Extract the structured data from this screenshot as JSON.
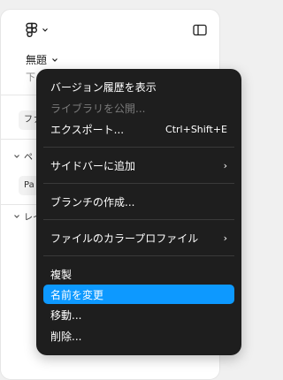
{
  "file": {
    "name": "無題",
    "subtitle": "下"
  },
  "left_panel": {
    "tab_label": "ファ",
    "pages_section": "ペ",
    "page_item": "Pa",
    "layers_section": "レイ"
  },
  "menu": {
    "items": [
      {
        "label": "バージョン履歴を表示",
        "shortcut": "",
        "submenu": false,
        "disabled": false
      },
      {
        "label": "ライブラリを公開...",
        "shortcut": "",
        "submenu": false,
        "disabled": true
      },
      {
        "label": "エクスポート...",
        "shortcut": "Ctrl+Shift+E",
        "submenu": false,
        "disabled": false
      },
      {
        "label": "サイドバーに追加",
        "shortcut": "",
        "submenu": true,
        "disabled": false
      },
      {
        "label": "ブランチの作成...",
        "shortcut": "",
        "submenu": false,
        "disabled": false
      },
      {
        "label": "ファイルのカラープロファイル",
        "shortcut": "",
        "submenu": true,
        "disabled": false
      },
      {
        "label": "複製",
        "shortcut": "",
        "submenu": false,
        "disabled": false
      },
      {
        "label": "名前を変更",
        "shortcut": "",
        "submenu": false,
        "disabled": false,
        "highlighted": true
      },
      {
        "label": "移動...",
        "shortcut": "",
        "submenu": false,
        "disabled": false
      },
      {
        "label": "削除...",
        "shortcut": "",
        "submenu": false,
        "disabled": false
      }
    ],
    "submenu_arrow": "›"
  },
  "colors": {
    "menu_bg": "#1e1e1e",
    "highlight": "#0d99ff"
  },
  "icons": {
    "logo": "figma-logo-icon",
    "layout": "sidebar-layout-icon"
  }
}
